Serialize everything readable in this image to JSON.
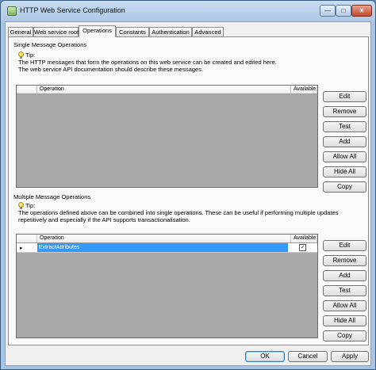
{
  "window": {
    "title": "HTTP Web Service Configuration"
  },
  "tabs": [
    {
      "label": "General",
      "active": false
    },
    {
      "label": "Web service root",
      "active": false
    },
    {
      "label": "Operations",
      "active": true
    },
    {
      "label": "Constants",
      "active": false
    },
    {
      "label": "Authentication",
      "active": false
    },
    {
      "label": "Advanced",
      "active": false
    }
  ],
  "single": {
    "section_label": "Single Message Operations",
    "tip_title": "Tip:",
    "tip_lines": [
      "The HTTP messages that form the operations on this web service can be created and edited here.",
      "The web service API documentation should describe these messages."
    ],
    "columns": [
      "Operation",
      "Available"
    ],
    "rows": [],
    "buttons": [
      "Edit",
      "Remove",
      "Test",
      "Add",
      "Allow All",
      "Hide All",
      "Copy"
    ]
  },
  "multiple": {
    "section_label": "Multiple Message Operations",
    "tip_title": "Tip:",
    "tip_lines": [
      "The operations defined above can be combined into single operations. These can be useful if performing multiple updates",
      "repetitively and especially if the API supports transactionalisation."
    ],
    "columns": [
      "Operation",
      "Available"
    ],
    "rows": [
      {
        "operation": "ExtractAttributes",
        "available": true,
        "selected": true
      }
    ],
    "buttons": [
      "Edit",
      "Remove",
      "Add",
      "Test",
      "Allow All",
      "Hide All",
      "Copy"
    ]
  },
  "footer": {
    "ok": "OK",
    "cancel": "Cancel",
    "apply": "Apply"
  },
  "icons": {
    "app": "app-icon",
    "tip": "lightbulb-icon",
    "row_indicator": "▸",
    "check": "✓"
  }
}
